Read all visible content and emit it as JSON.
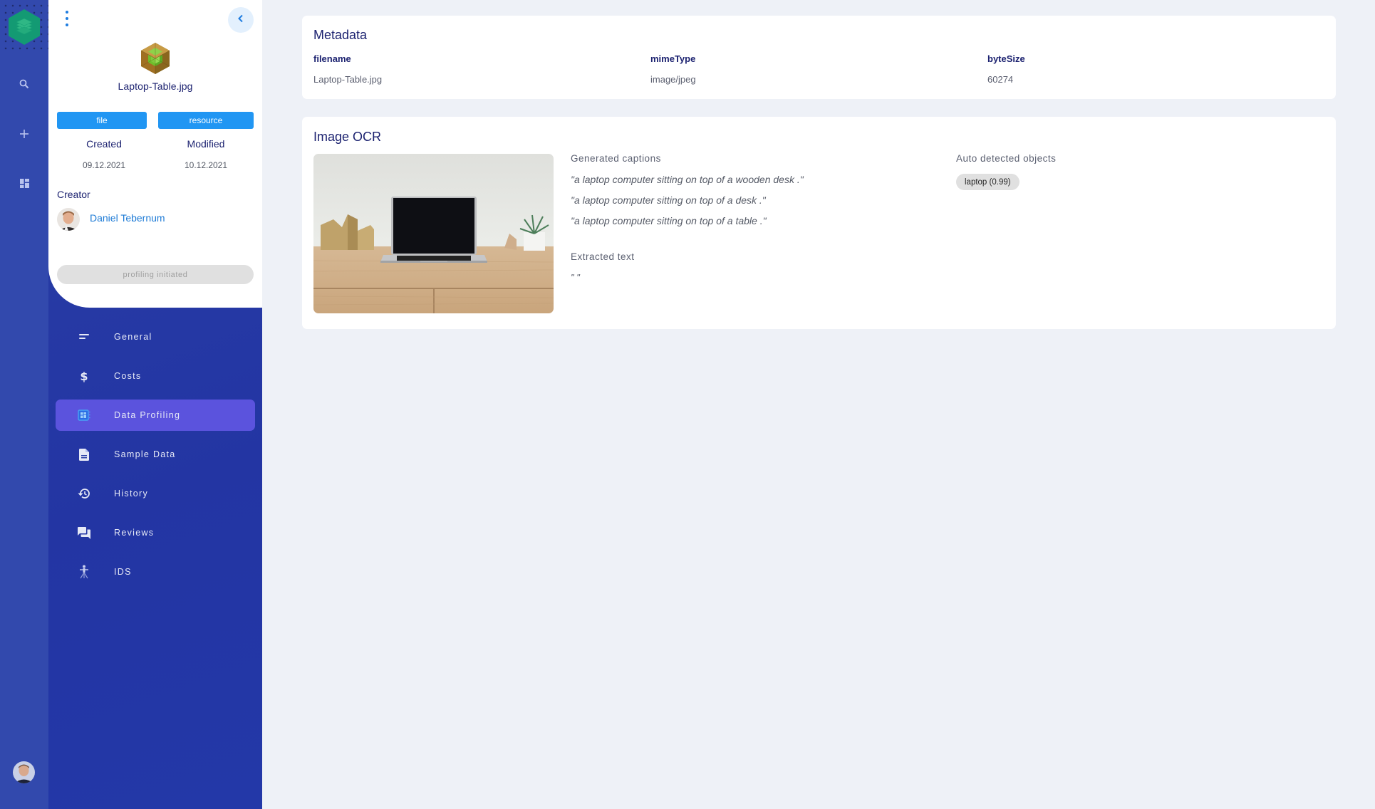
{
  "rail": {
    "logo_icon": "layers-hexagon-logo",
    "items": [
      {
        "icon": "search-icon"
      },
      {
        "icon": "plus-icon"
      },
      {
        "icon": "dashboard-icon"
      }
    ],
    "user_avatar": "user-avatar"
  },
  "detail": {
    "file_name": "Laptop-Table.jpg",
    "tags": [
      "file",
      "resource"
    ],
    "created_label": "Created",
    "created_value": "09.12.2021",
    "modified_label": "Modified",
    "modified_value": "10.12.2021",
    "creator_label": "Creator",
    "creator_name": "Daniel Tebernum",
    "status": "profiling initiated"
  },
  "nav": {
    "items": [
      {
        "label": "General",
        "icon": "subject-lines-icon",
        "active": false
      },
      {
        "label": "Costs",
        "icon": "dollar-icon",
        "active": false
      },
      {
        "label": "Data Profiling",
        "icon": "data-profiling-icon",
        "active": true
      },
      {
        "label": "Sample Data",
        "icon": "document-icon",
        "active": false
      },
      {
        "label": "History",
        "icon": "history-icon",
        "active": false
      },
      {
        "label": "Reviews",
        "icon": "chat-icon",
        "active": false
      },
      {
        "label": "IDS",
        "icon": "ids-connector-icon",
        "active": false
      }
    ]
  },
  "metadata": {
    "title": "Metadata",
    "fields": [
      {
        "key": "filename",
        "value": "Laptop-Table.jpg"
      },
      {
        "key": "mimeType",
        "value": "image/jpeg"
      },
      {
        "key": "byteSize",
        "value": "60274"
      }
    ]
  },
  "ocr": {
    "title": "Image OCR",
    "captions_label": "Generated captions",
    "captions": [
      "\"a laptop computer sitting on top of a wooden desk .\"",
      "\"a laptop computer sitting on top of a desk .\"",
      "\"a laptop computer sitting on top of a table .\""
    ],
    "extracted_label": "Extracted text",
    "extracted_value": "\"   \"",
    "objects_label": "Auto detected objects",
    "objects": [
      "laptop (0.99)"
    ]
  },
  "colors": {
    "rail_bg": "#3249ad",
    "nav_bg": "#2335a3",
    "nav_active": "#5b53dd",
    "tag_blue": "#2196f3",
    "title_navy": "#1c2270",
    "link_blue": "#1e7bd6",
    "page_bg": "#eef1f7"
  }
}
